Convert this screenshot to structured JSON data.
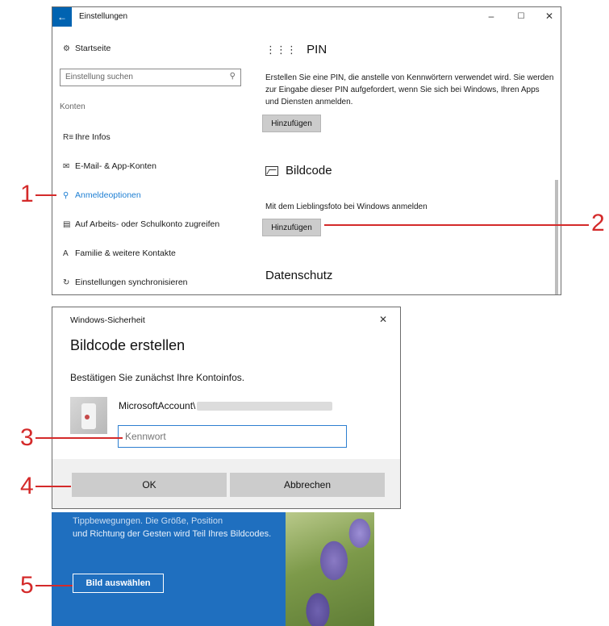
{
  "settings": {
    "back_icon": "back-arrow-icon",
    "title": "Einstellungen",
    "home": "Startseite",
    "search_placeholder": "Einstellung suchen",
    "section": "Konten",
    "nav": [
      {
        "label": "Ihre Infos",
        "icon": "person-info-icon"
      },
      {
        "label": "E-Mail- & App-Konten",
        "icon": "mail-icon"
      },
      {
        "label": "Anmeldeoptionen",
        "icon": "key-icon"
      },
      {
        "label": "Auf Arbeits- oder Schulkonto zugreifen",
        "icon": "briefcase-icon"
      },
      {
        "label": "Familie & weitere Kontakte",
        "icon": "people-icon"
      },
      {
        "label": "Einstellungen synchronisieren",
        "icon": "sync-icon"
      }
    ],
    "pin": {
      "heading": "PIN",
      "description": "Erstellen Sie eine PIN, die anstelle von Kennwörtern verwendet wird. Sie werden zur Eingabe dieser PIN aufgefordert, wenn Sie sich bei Windows, Ihren Apps und Diensten anmelden.",
      "button": "Hinzufügen"
    },
    "bildcode": {
      "heading": "Bildcode",
      "description": "Mit dem Lieblingsfoto bei Windows anmelden",
      "button": "Hinzufügen"
    },
    "datenschutz": "Datenschutz"
  },
  "dialog": {
    "caption": "Windows-Sicherheit",
    "title": "Bildcode erstellen",
    "description": "Bestätigen Sie zunächst Ihre Kontoinfos.",
    "account": "MicrosoftAccount\\",
    "password_placeholder": "Kennwort",
    "ok": "OK",
    "cancel": "Abbrechen"
  },
  "panel": {
    "text_cut": "Tippbewegungen. Die Größe, Position",
    "text": "und Richtung der Gesten wird Teil Ihres Bildcodes.",
    "button": "Bild auswählen"
  },
  "callouts": [
    "1",
    "2",
    "3",
    "4",
    "5"
  ],
  "colors": {
    "accent": "#0063b1",
    "callout": "#d42a2a",
    "panel": "#1f6fbf"
  }
}
